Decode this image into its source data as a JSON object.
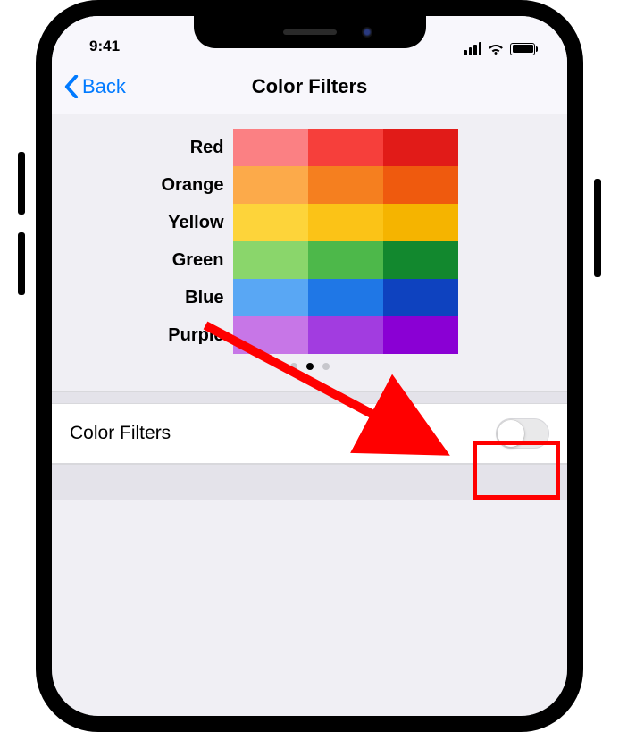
{
  "status": {
    "time": "9:41"
  },
  "nav": {
    "back_label": "Back",
    "title": "Color Filters"
  },
  "colors": {
    "labels": [
      "Red",
      "Orange",
      "Yellow",
      "Green",
      "Blue",
      "Purple"
    ],
    "grid": [
      [
        "#fb8083",
        "#f63f3b",
        "#e11b18"
      ],
      [
        "#fcaa4a",
        "#f57f1f",
        "#ef5a0e"
      ],
      [
        "#fdd43a",
        "#fbc317",
        "#f5b400"
      ],
      [
        "#8ad66b",
        "#4db84a",
        "#12882e"
      ],
      [
        "#59a7f4",
        "#1f77e6",
        "#0e42bf"
      ],
      [
        "#c776e7",
        "#a23ce0",
        "#8a00d4"
      ]
    ]
  },
  "pager": {
    "count": 3,
    "active": 1
  },
  "setting": {
    "label": "Color Filters",
    "enabled": false
  }
}
